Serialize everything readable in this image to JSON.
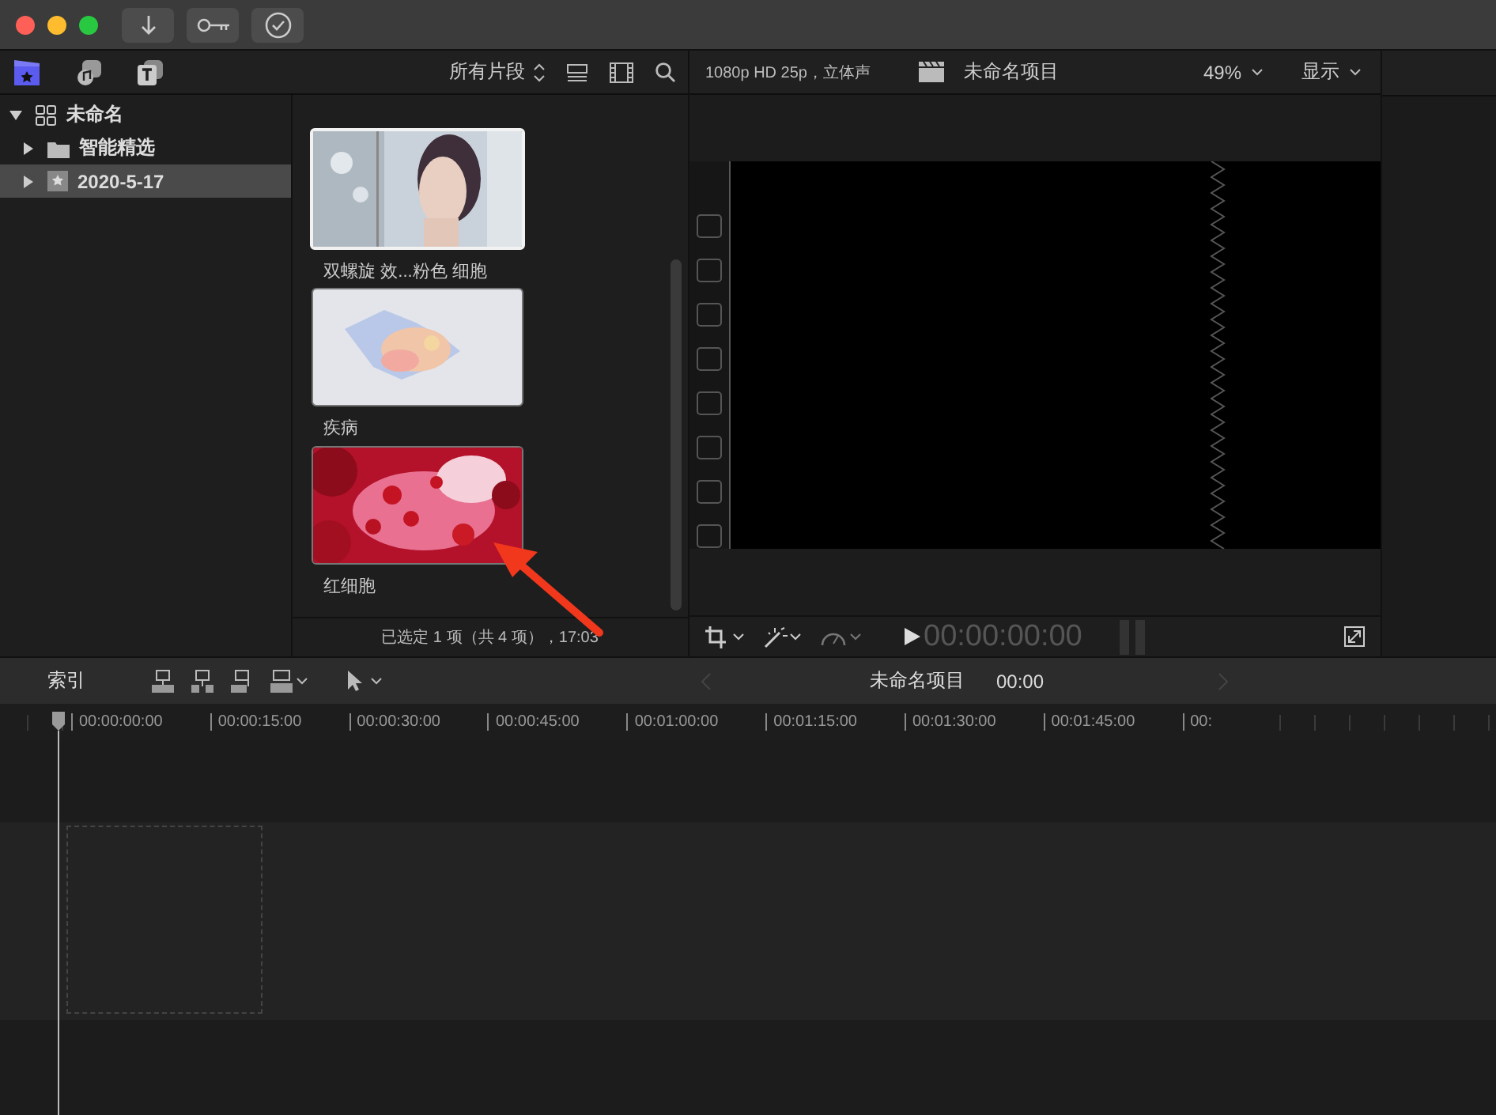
{
  "browser_toolbar": {
    "filter": "所有片段"
  },
  "libraries": [
    {
      "label": "未命名",
      "kind": "library",
      "expanded": true,
      "selected": false,
      "children": [
        {
          "label": "智能精选",
          "kind": "folder",
          "expanded": false,
          "selected": false
        },
        {
          "label": "2020-5-17",
          "kind": "event",
          "expanded": false,
          "selected": true
        }
      ]
    }
  ],
  "clips": [
    {
      "title": "双螺旋 效...粉色 细胞",
      "selected": true,
      "kind": "portrait"
    },
    {
      "title": "疾病",
      "selected": false,
      "kind": "diagram"
    },
    {
      "title": "红细胞",
      "selected": false,
      "kind": "cells"
    }
  ],
  "browser_status": "已选定 1 项（共 4 项），17:03",
  "viewer": {
    "format": "1080p HD 25p，立体声",
    "project": "未命名项目",
    "zoom": "49%",
    "display": "显示",
    "timecode": "00:00:00:00"
  },
  "timeline": {
    "index_button": "索引",
    "project": "未命名项目",
    "duration": "00:00",
    "ruler": [
      "00:00:00:00",
      "00:00:15:00",
      "00:00:30:00",
      "00:00:45:00",
      "00:01:00:00",
      "00:01:15:00",
      "00:01:30:00",
      "00:01:45:00",
      "00:"
    ]
  }
}
